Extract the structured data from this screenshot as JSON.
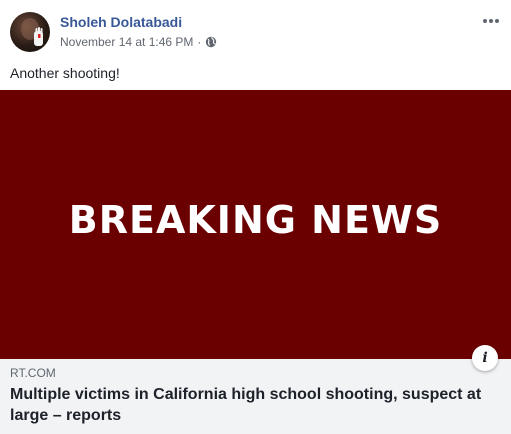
{
  "post": {
    "author": "Sholeh Dolatabadi",
    "timestamp": "November 14 at 1:46 PM",
    "separator": "·",
    "privacy_icon": "globe-icon",
    "more_icon": "more-options-icon",
    "text": "Another shooting!"
  },
  "link": {
    "image_text": "BREAKING NEWS",
    "image_bg_color": "#6b0000",
    "info_icon": "i",
    "domain": "RT.COM",
    "headline": "Multiple victims in California high school shooting, suspect at large – reports"
  },
  "colors": {
    "author_link": "#385898",
    "caption_bg": "#f2f3f5"
  }
}
